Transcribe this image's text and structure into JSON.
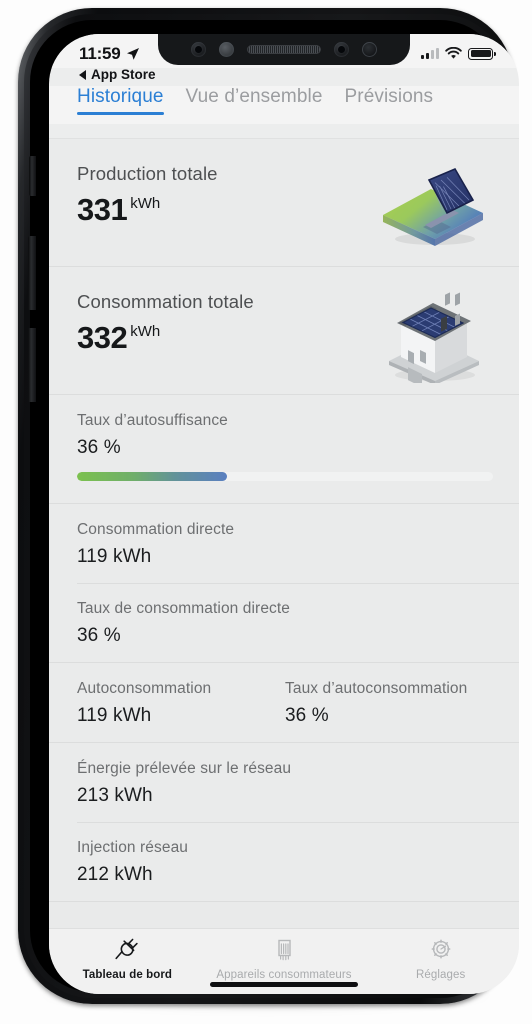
{
  "status_bar": {
    "time": "11:59",
    "location_icon": "location-arrow-icon",
    "signal_icon": "cellular-signal-icon",
    "signal_bars_filled": 2,
    "signal_bars_total": 4,
    "wifi_icon": "wifi-icon",
    "battery_icon": "battery-icon"
  },
  "back_link": {
    "label": "App Store",
    "icon": "back-caret-icon"
  },
  "top_tabs": [
    {
      "label": "Historique",
      "active": true
    },
    {
      "label": "Vue d’ensemble",
      "active": false
    },
    {
      "label": "Prévisions",
      "active": false
    }
  ],
  "colors": {
    "accent": "#2b7fd4",
    "progress_start": "#7cc14f",
    "progress_end": "#5a7fc0",
    "screen_bg": "#eaebeb"
  },
  "hero_cards": [
    {
      "label": "Production totale",
      "value": "331",
      "unit": "kWh",
      "icon": "solar-panel-icon"
    },
    {
      "label": "Consommation totale",
      "value": "332",
      "unit": "kWh",
      "icon": "house-with-solar-icon"
    }
  ],
  "self_sufficiency": {
    "label": "Taux d’autosuffisance",
    "value": "36 %",
    "percent": 36
  },
  "rows": [
    {
      "label": "Consommation directe",
      "value": "119 kWh"
    },
    {
      "label": "Taux de consommation directe",
      "value": "36 %"
    }
  ],
  "row_pair": {
    "left": {
      "label": "Autoconsommation",
      "value": "119 kWh"
    },
    "right": {
      "label": "Taux d’autoconsommation",
      "value": "36 %"
    }
  },
  "rows_grid": [
    {
      "label": "Énergie prélevée sur le réseau",
      "value": "213 kWh"
    },
    {
      "label": "Injection réseau",
      "value": "212 kWh"
    }
  ],
  "bottom_tabs": [
    {
      "label": "Tableau de bord",
      "icon": "power-plug-icon",
      "active": true
    },
    {
      "label": "Appareils consommateurs",
      "icon": "appliance-icon",
      "active": false
    },
    {
      "label": "Réglages",
      "icon": "gear-icon",
      "active": false
    }
  ]
}
